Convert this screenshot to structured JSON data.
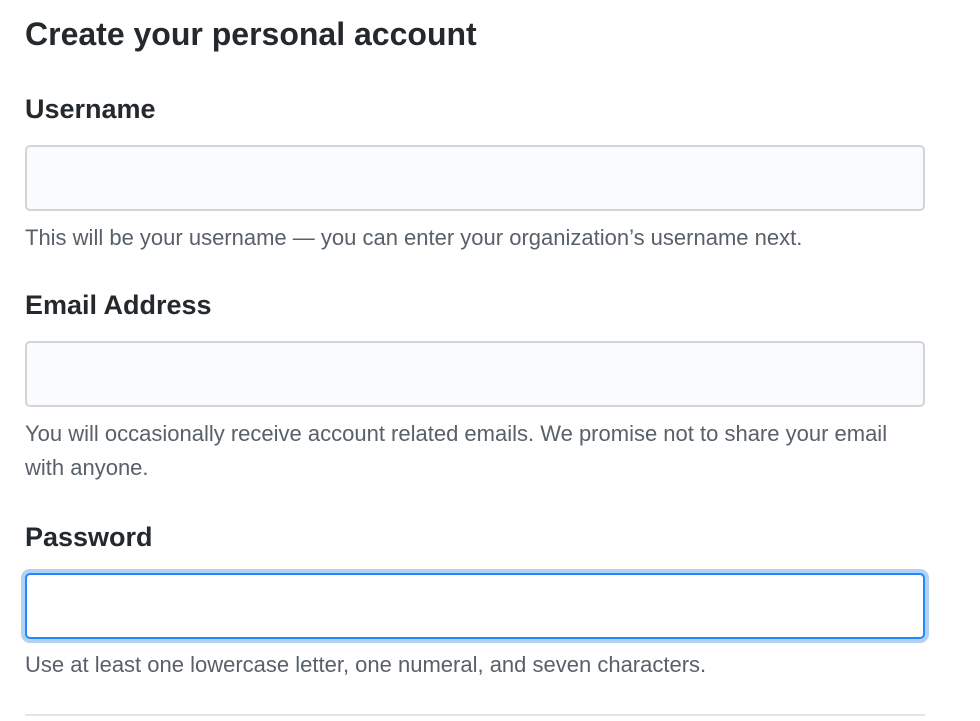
{
  "form": {
    "title": "Create your personal account",
    "username": {
      "label": "Username",
      "value": "",
      "note": "This will be your username — you can enter your organization’s username next."
    },
    "email": {
      "label": "Email Address",
      "value": "",
      "note": "You will occasionally receive account related emails. We promise not to share your email with anyone."
    },
    "password": {
      "label": "Password",
      "value": "",
      "focused": true,
      "note": "Use at least one lowercase letter, one numeral, and seven characters."
    }
  },
  "colors": {
    "text": "#24292e",
    "muted": "#586069",
    "input_bg": "#fafbfc",
    "input_border": "#d1d5da",
    "focus_border": "#2188ff"
  }
}
